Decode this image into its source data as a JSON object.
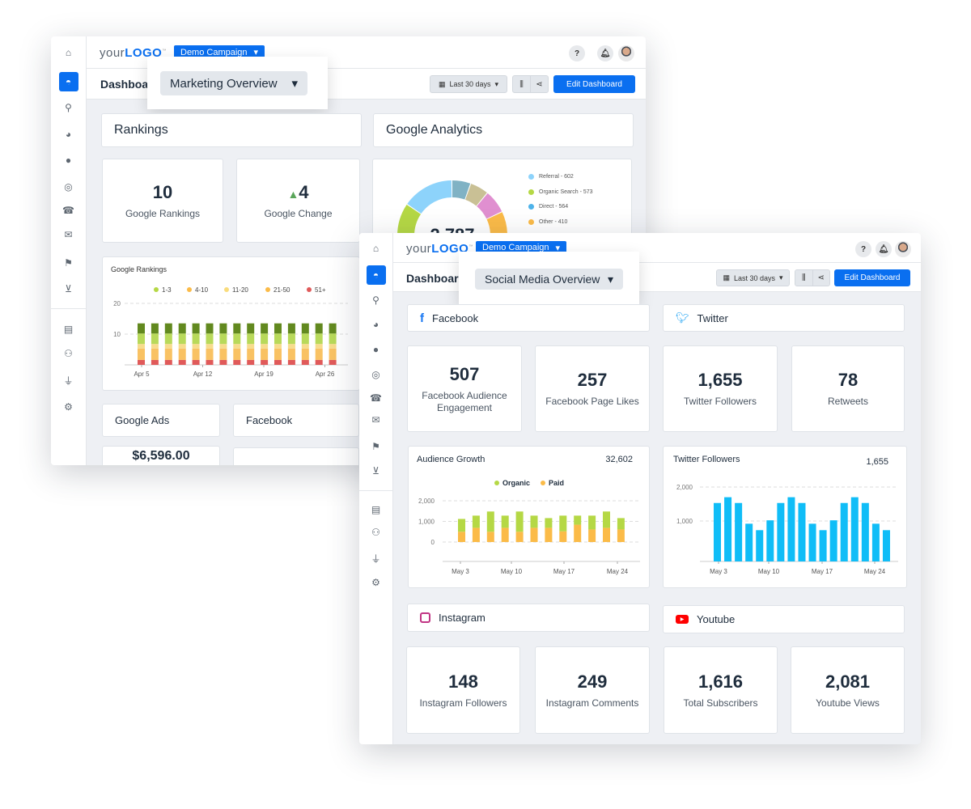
{
  "sidebar_icons": [
    "home-icon",
    "dashboard-icon",
    "search-icon",
    "pie-chart-icon",
    "comment-icon",
    "target-icon",
    "phone-icon",
    "envelope-icon",
    "map-pin-icon",
    "cart-icon",
    "file-icon",
    "users-icon",
    "plug-icon",
    "gear-icon"
  ],
  "colors": {
    "accent": "#0a6ff0",
    "background": "#eef0f4"
  },
  "back": {
    "logo_prefix": "your",
    "logo_main": "LOGO",
    "logo_tm": "™",
    "campaign": "Demo Campaign",
    "dashboard_label": "Dashboard",
    "dashboard_select": "Marketing Overview",
    "date_range": "Last 30 days",
    "edit_button": "Edit Dashboard",
    "help": "?",
    "sections": {
      "rankings": "Rankings",
      "google_analytics": "Google Analytics",
      "google_ads": "Google Ads",
      "facebook": "Facebook"
    },
    "stats": [
      {
        "value": "10",
        "label": "Google Rankings"
      },
      {
        "value": "4",
        "label": "Google Change",
        "trend": "up"
      }
    ],
    "ads_value": "$6,596.00",
    "analytics": {
      "total": "2,787",
      "legend": [
        {
          "label": "Referral - 602",
          "color": "#8dd3fb"
        },
        {
          "label": "Organic Search - 573",
          "color": "#b5d845"
        },
        {
          "label": "Direct - 564",
          "color": "#4eb3ea"
        },
        {
          "label": "Other - 410",
          "color": "#fbbb48"
        }
      ]
    }
  },
  "front": {
    "logo_prefix": "your",
    "logo_main": "LOGO",
    "logo_tm": "™",
    "campaign": "Demo Campaign",
    "dashboard_label": "Dashboard",
    "dashboard_select": "Social Media Overview",
    "date_range": "Last 30 days",
    "edit_button": "Edit Dashboard",
    "help": "?",
    "sections": {
      "facebook": "Facebook",
      "twitter": "Twitter",
      "instagram": "Instagram",
      "youtube": "Youtube"
    },
    "stats_row1": [
      {
        "value": "507",
        "label": "Facebook Audience Engagement"
      },
      {
        "value": "257",
        "label": "Facebook Page Likes"
      },
      {
        "value": "1,655",
        "label": "Twitter Followers"
      },
      {
        "value": "78",
        "label": "Retweets"
      }
    ],
    "stats_row2": [
      {
        "value": "148",
        "label": "Instagram Followers"
      },
      {
        "value": "249",
        "label": "Instagram Comments"
      },
      {
        "value": "1,616",
        "label": "Total Subscribers"
      },
      {
        "value": "2,081",
        "label": "Youtube Views"
      }
    ],
    "audience_total": "32,602",
    "twitter_total": "1,655"
  },
  "chart_data": [
    {
      "type": "bar",
      "stacked": true,
      "title": "Google Rankings",
      "ylim": [
        0,
        20
      ],
      "yticks": [
        "20",
        "10"
      ],
      "ytick_values": [
        20,
        10
      ],
      "xticks": [
        "Apr 5",
        "Apr 12",
        "Apr 19",
        "Apr 26"
      ],
      "grid": true,
      "legend_placement": "top",
      "legend": [
        {
          "name": "1-3",
          "color": "#b5d845"
        },
        {
          "name": "4-10",
          "color": "#fbbb48"
        },
        {
          "name": "11-20",
          "color": "#f9dc7c"
        },
        {
          "name": "21-50",
          "color": "#fbbb48"
        },
        {
          "name": "51+",
          "color": "#e05a5a"
        }
      ],
      "bar_count": 15,
      "stack": [
        {
          "value": 1.6,
          "color": "#e05a5a"
        },
        {
          "value": 3.7,
          "color": "#f9c263"
        },
        {
          "value": 1.5,
          "color": "#f7dc8c"
        },
        {
          "value": 3.4,
          "color": "#b8d95a"
        },
        {
          "value": 3.3,
          "color": "#62891f"
        }
      ]
    },
    {
      "type": "bar",
      "stacked": true,
      "title": "Audience Growth",
      "ylim": [
        -940,
        2000
      ],
      "yticks": [
        "2,000",
        "1,000",
        "0"
      ],
      "ytick_values": [
        2000,
        1000,
        0
      ],
      "xticks": [
        "May 3",
        "May 10",
        "May 17",
        "May 24"
      ],
      "grid": true,
      "legend_placement": "top",
      "series": [
        {
          "name": "Paid",
          "color": "#fbbb48",
          "values": [
            500,
            690,
            500,
            690,
            500,
            690,
            690,
            520,
            840,
            610,
            690,
            610
          ]
        },
        {
          "name": "Organic",
          "color": "#b5d845",
          "values": [
            620,
            590,
            980,
            590,
            980,
            590,
            470,
            760,
            440,
            670,
            790,
            550
          ]
        }
      ]
    },
    {
      "type": "bar",
      "title": "Twitter Followers",
      "ylim": [
        -190,
        2000
      ],
      "yticks": [
        "2,000",
        "1,000"
      ],
      "ytick_values": [
        2000,
        1000
      ],
      "xticks": [
        "May 3",
        "May 10",
        "May 17",
        "May 24"
      ],
      "grid": true,
      "series": [
        {
          "color": "#10bdf7",
          "values": [
            1530,
            1700,
            1530,
            920,
            730,
            1020,
            1530,
            1700,
            1530,
            920,
            730,
            1020,
            1530,
            1700,
            1530,
            920,
            730
          ]
        }
      ]
    }
  ]
}
